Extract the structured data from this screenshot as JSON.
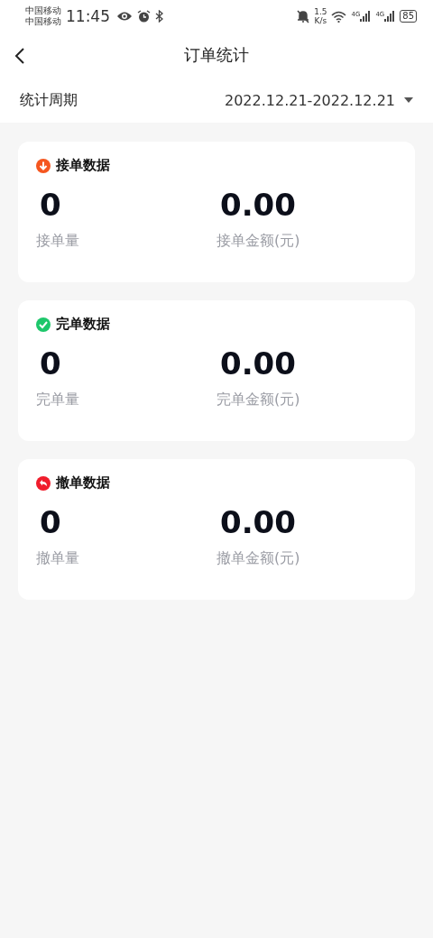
{
  "status_bar": {
    "carriers": [
      "中国移动",
      "中国移动"
    ],
    "time": "11:45",
    "speed_value": "1.5",
    "speed_unit": "K/s",
    "networks": [
      "4G",
      "4G"
    ],
    "battery": "85"
  },
  "header": {
    "title": "订单统计"
  },
  "period": {
    "label": "统计周期",
    "value": "2022.12.21-2022.12.21"
  },
  "cards": [
    {
      "kind": "received",
      "title": "接单数据",
      "count": "0",
      "count_label": "接单量",
      "amount": "0.00",
      "amount_label": "接单金额(元)"
    },
    {
      "kind": "completed",
      "title": "完单数据",
      "count": "0",
      "count_label": "完单量",
      "amount": "0.00",
      "amount_label": "完单金额(元)"
    },
    {
      "kind": "cancelled",
      "title": "撤单数据",
      "count": "0",
      "count_label": "撤单量",
      "amount": "0.00",
      "amount_label": "撤单金额(元)"
    }
  ]
}
